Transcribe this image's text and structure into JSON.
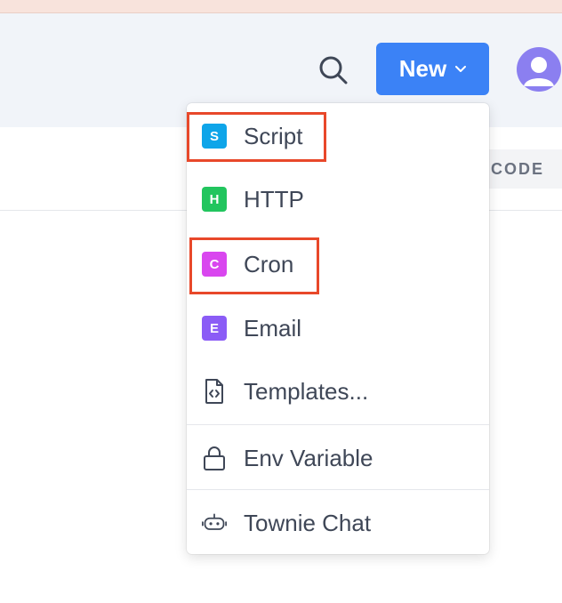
{
  "header": {
    "new_button_label": "New",
    "code_chip_label": "CODE"
  },
  "menu": {
    "items": [
      {
        "key": "script",
        "label": "Script",
        "badge": "S",
        "color": "#0ea5e9"
      },
      {
        "key": "http",
        "label": "HTTP",
        "badge": "H",
        "color": "#22c55e"
      },
      {
        "key": "cron",
        "label": "Cron",
        "badge": "C",
        "color": "#d946ef"
      },
      {
        "key": "email",
        "label": "Email",
        "badge": "E",
        "color": "#8b5cf6"
      },
      {
        "key": "templates",
        "label": "Templates...",
        "icon": "file-code-icon"
      },
      {
        "key": "env",
        "label": "Env Variable",
        "icon": "lock-icon"
      },
      {
        "key": "townie",
        "label": "Townie Chat",
        "icon": "bot-icon"
      }
    ]
  },
  "highlight_color": "#e8482a"
}
